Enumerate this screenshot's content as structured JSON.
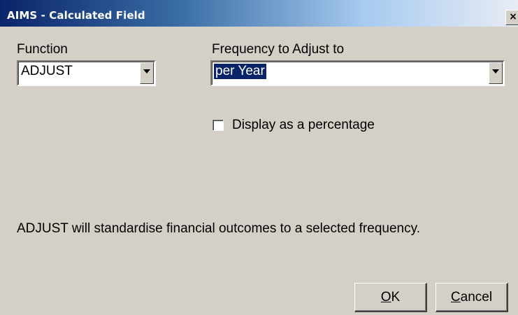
{
  "window": {
    "title": "AIMS - Calculated Field",
    "close_glyph": "×"
  },
  "function_field": {
    "label": "Function",
    "value": "ADJUST",
    "icon": "chevron-down-icon"
  },
  "frequency_field": {
    "label": "Frequency to Adjust to",
    "value": "per Year",
    "icon": "chevron-down-icon"
  },
  "percentage_option": {
    "label": "Display as a percentage",
    "checked": false
  },
  "description": "ADJUST will standardise financial outcomes to a selected frequency.",
  "buttons": {
    "ok": {
      "accel": "O",
      "rest": "K"
    },
    "cancel": {
      "accel": "C",
      "rest": "ancel"
    }
  },
  "colors": {
    "dialog_bg": "#d4d0c8",
    "title_gradient_start": "#0a246a",
    "selection_bg": "#0a246a"
  }
}
